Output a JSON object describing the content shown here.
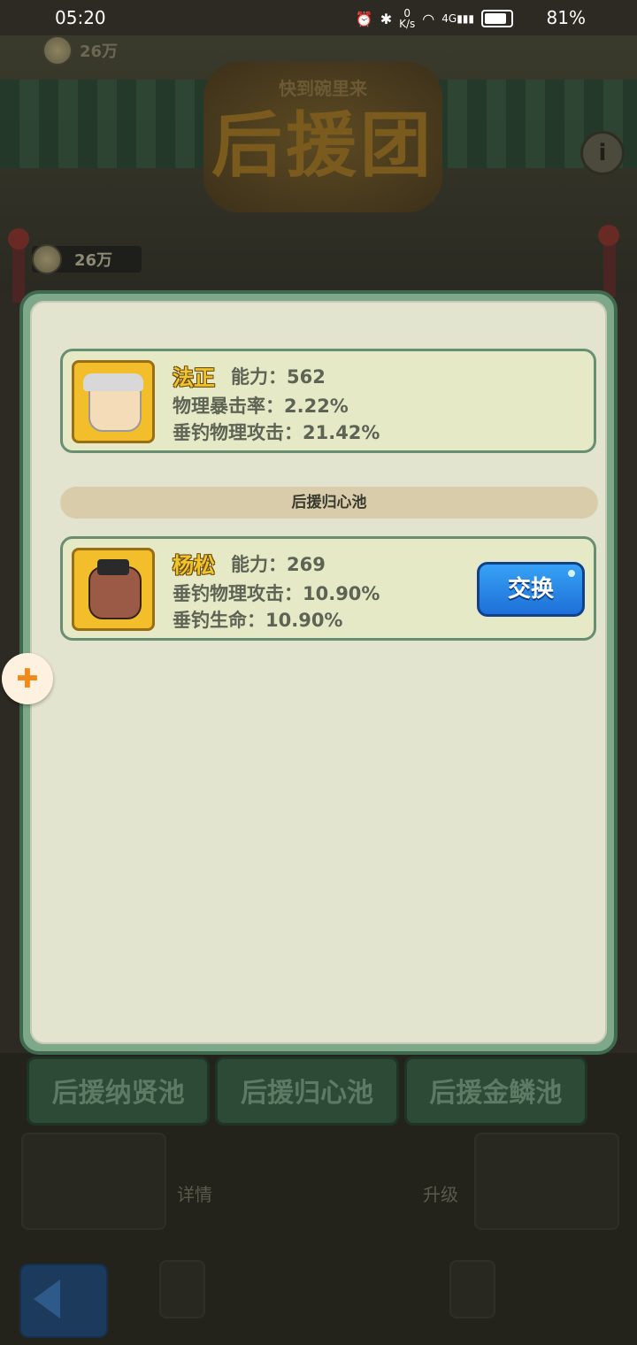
{
  "status_bar": {
    "time": "05:20",
    "net_speed_value": "0",
    "net_speed_unit": "K/s",
    "signal_label": "4G",
    "battery": "81%"
  },
  "background": {
    "currency_top": "26万",
    "currency_mid": "26万",
    "title_sub": "快到碗里来",
    "title": "后援团",
    "info_icon": "i",
    "tabs": [
      "后援纳贤池",
      "后援归心池",
      "后援金鳞池"
    ],
    "detail_label": "详情",
    "upgrade_label": "升级"
  },
  "modal": {
    "current_card": {
      "name": "法正",
      "ability": "能力：562",
      "stat1": "物理暴击率：2.22%",
      "stat2": "垂钓物理攻击：21.42%",
      "portrait_icon": "fazheng-portrait"
    },
    "pool_banner": "后援归心池",
    "pool_card": {
      "name": "杨松",
      "ability": "能力：269",
      "stat1": "垂钓物理攻击：10.90%",
      "stat2": "垂钓生命：10.90%",
      "portrait_icon": "yangsong-portrait",
      "swap_label": "交换"
    }
  },
  "floating_button": {
    "icon": "gamepad-icon"
  },
  "colors": {
    "portrait_bg": "#f2be2c",
    "card_border": "#6a8e72",
    "swap_button": "#1e6fd8",
    "modal_bg": "#e3e4cf"
  }
}
